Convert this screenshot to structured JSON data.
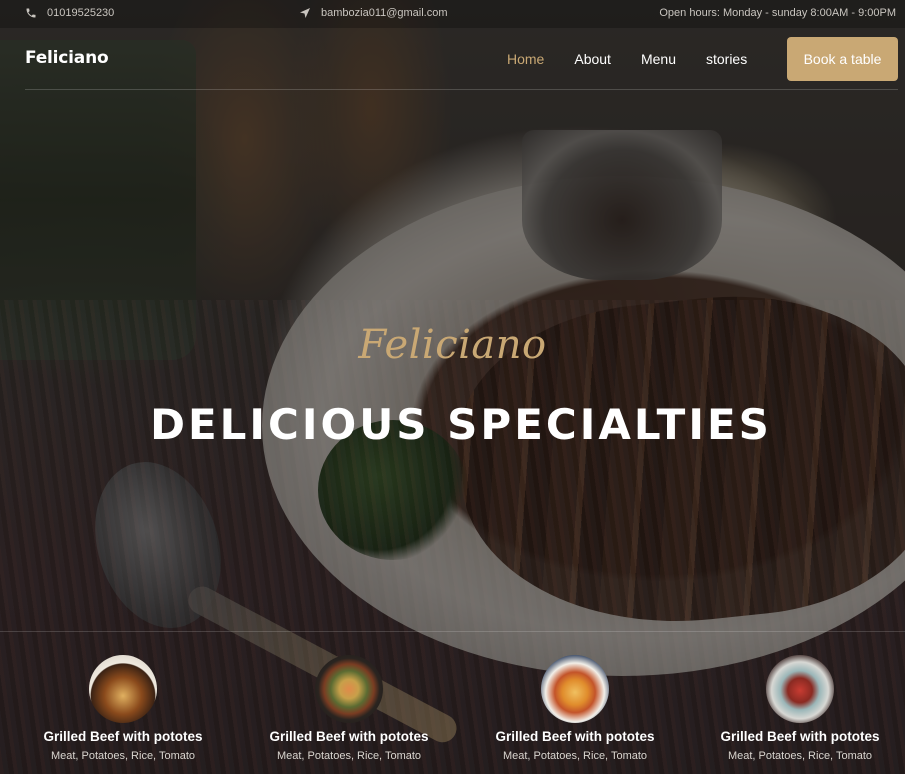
{
  "topbar": {
    "phone": "01019525230",
    "email": "bambozia011@gmail.com",
    "hours": "Open hours: Monday - sunday 8:00AM - 9:00PM"
  },
  "nav": {
    "brand": "Feliciano",
    "links": [
      "Home",
      "About",
      "Menu",
      "stories"
    ],
    "active": "Home",
    "cta": "Book a table"
  },
  "hero": {
    "script_title": "Feliciano",
    "title": "DELICIOUS SPECIALTIES"
  },
  "dishes": [
    {
      "name": "Grilled Beef with pototes",
      "desc": "Meat, Potatoes, Rice, Tomato"
    },
    {
      "name": "Grilled Beef with pototes",
      "desc": "Meat, Potatoes, Rice, Tomato"
    },
    {
      "name": "Grilled Beef with pototes",
      "desc": "Meat, Potatoes, Rice, Tomato"
    },
    {
      "name": "Grilled Beef with pototes",
      "desc": "Meat, Potatoes, Rice, Tomato"
    }
  ],
  "colors": {
    "accent": "#c9a874",
    "text": "#ffffff"
  }
}
